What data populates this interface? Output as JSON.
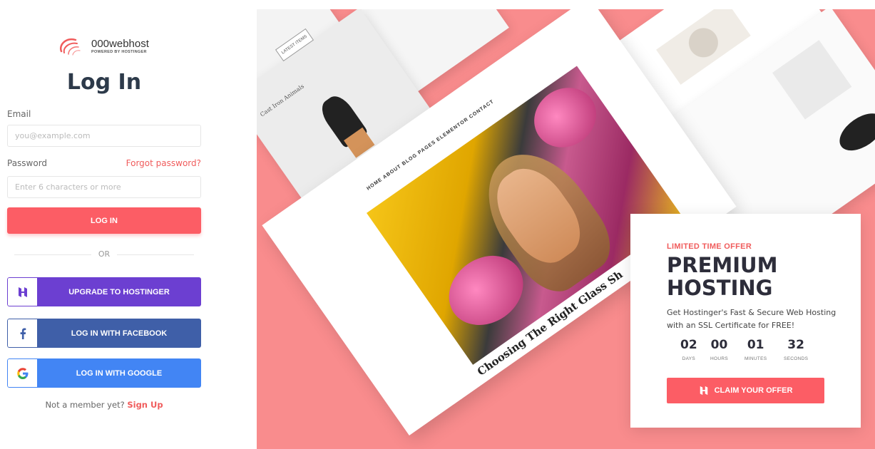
{
  "brand": {
    "name": "000webhost",
    "sub": "POWERED BY HOSTINGER"
  },
  "login": {
    "title": "Log In",
    "email_label": "Email",
    "email_placeholder": "you@example.com",
    "password_label": "Password",
    "forgot": "Forgot password?",
    "password_placeholder": "Enter 6 characters or more",
    "login_button": "LOG IN",
    "or": "OR",
    "social": [
      {
        "label": "UPGRADE TO HOSTINGER"
      },
      {
        "label": "LOG IN WITH FACEBOOK"
      },
      {
        "label": "LOG IN WITH GOOGLE"
      }
    ],
    "signup_prompt": "Not a member yet?",
    "signup_link": "Sign Up"
  },
  "hero": {
    "nav": "HOME  ABOUT  BLOG  PAGES  ELEMENTOR  CONTACT",
    "caption": "Choosing The Right Glass Sh",
    "product1": "Cast Iron Animals",
    "product2": "LATEST ITEMS"
  },
  "offer": {
    "tag": "LIMITED TIME OFFER",
    "headline1": "PREMIUM",
    "headline2": "HOSTING",
    "description": "Get Hostinger's Fast & Secure Web Hosting with an SSL Certificate for FREE!",
    "countdown": [
      {
        "value": "02",
        "unit": "DAYS"
      },
      {
        "value": "00",
        "unit": "HOURS"
      },
      {
        "value": "01",
        "unit": "MINUTES"
      },
      {
        "value": "32",
        "unit": "SECONDS"
      }
    ],
    "cta": "CLAIM YOUR OFFER"
  },
  "colors": {
    "accent": "#fc5d65",
    "hostinger": "#6c3fd1",
    "facebook": "#3f5fa8",
    "google": "#4285f4",
    "hero_bg": "#f98c8d"
  }
}
